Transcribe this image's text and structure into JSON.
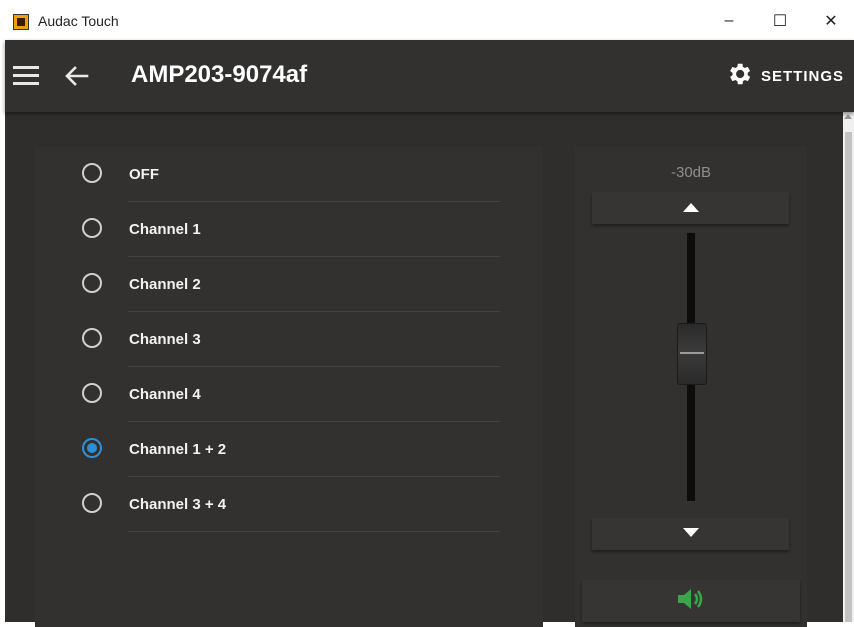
{
  "window": {
    "title": "Audac Touch",
    "minimize_glyph": "–",
    "maximize_glyph": "☐",
    "close_glyph": "✕"
  },
  "toolbar": {
    "device_name": "AMP203-9074af",
    "settings_label": "SETTINGS",
    "icons": [
      "menu-icon",
      "back-arrow-icon",
      "gear-icon"
    ]
  },
  "source_options": [
    {
      "label": "OFF",
      "selected": false
    },
    {
      "label": "Channel 1",
      "selected": false
    },
    {
      "label": "Channel 2",
      "selected": false
    },
    {
      "label": "Channel 3",
      "selected": false
    },
    {
      "label": "Channel 4",
      "selected": false
    },
    {
      "label": "Channel 1 + 2",
      "selected": true
    },
    {
      "label": "Channel 3 + 4",
      "selected": false
    }
  ],
  "volume": {
    "level_text": "-30dB",
    "slider_fraction": 0.57,
    "icons": [
      "volume-up-arrow-icon",
      "volume-down-arrow-icon",
      "speaker-icon"
    ]
  },
  "colors": {
    "background": "#2f2e2c",
    "accent_radio": "#2e8fd6",
    "speaker_green": "#3ba54a"
  }
}
